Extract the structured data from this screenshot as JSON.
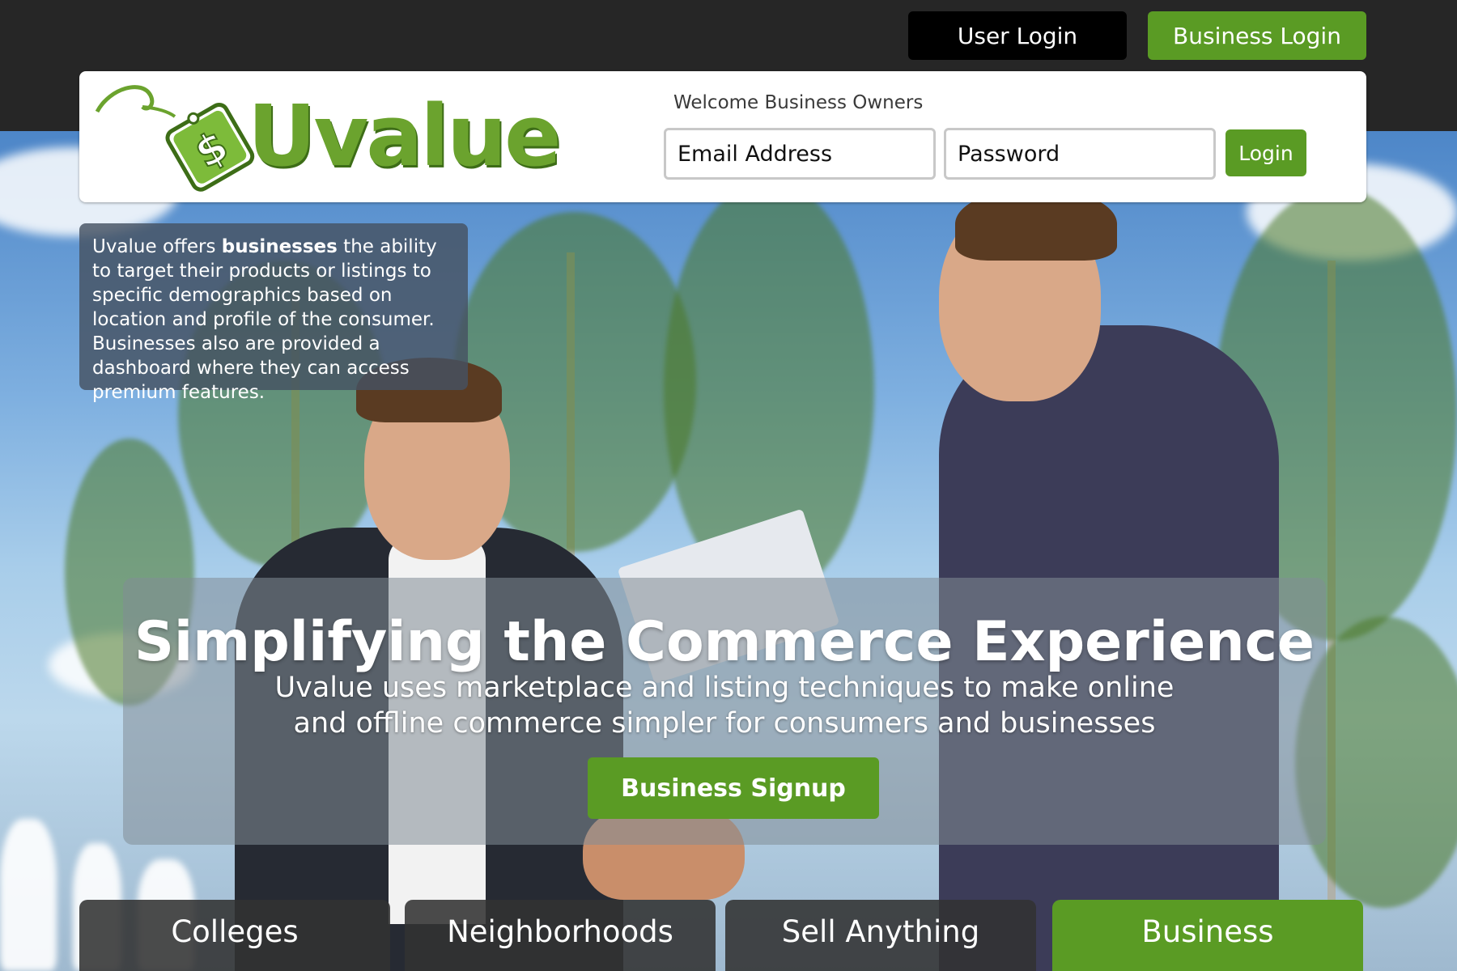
{
  "top_nav": {
    "user_login_label": "User Login",
    "business_login_label": "Business Login"
  },
  "header": {
    "logo_text": "Uvalue",
    "welcome_text": "Welcome Business Owners",
    "email_placeholder": "Email Address",
    "password_placeholder": "Password",
    "login_label": "Login"
  },
  "info_box": {
    "text_before": "Uvalue offers ",
    "text_bold": "businesses",
    "text_after": " the ability to target their products or listings to specific demographics based on location and profile of the consumer. Businesses also are provided a dashboard where they can access premium features."
  },
  "banner": {
    "title": "Simplifying the Commerce Experience",
    "subtitle_line1": "Uvalue uses marketplace and listing techniques to make online",
    "subtitle_line2": "and offline commerce simpler for consumers and businesses",
    "signup_label": "Business Signup"
  },
  "tabs": [
    {
      "label": "Colleges"
    },
    {
      "label": "Neighborhoods"
    },
    {
      "label": "Sell Anything"
    },
    {
      "label": "Business",
      "active": true
    }
  ],
  "colors": {
    "brand_green": "#5a9b24",
    "logo_green": "#6ba32e",
    "dark_bar": "#262626"
  },
  "icons": {
    "logo_mark": "dollar-price-tag-icon"
  }
}
